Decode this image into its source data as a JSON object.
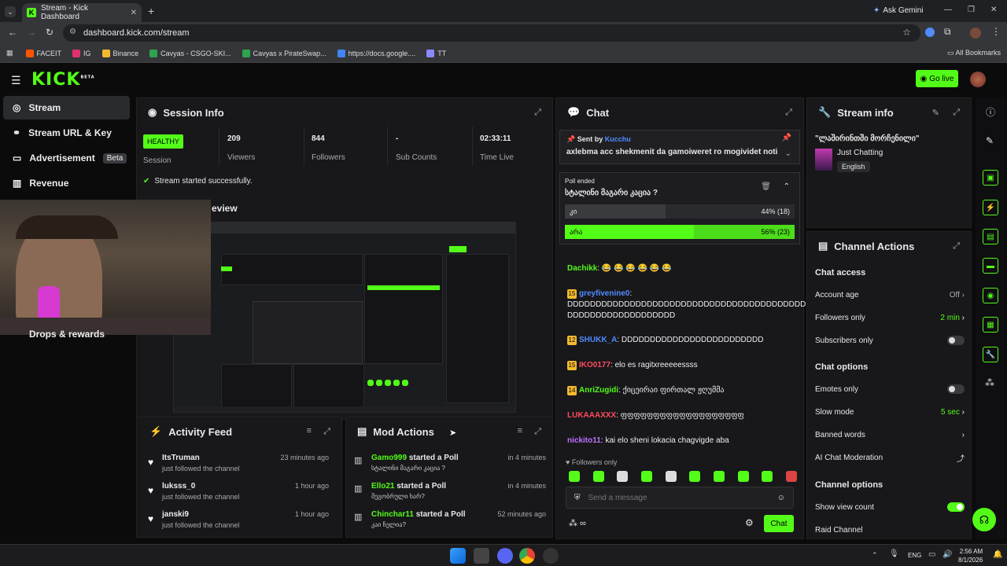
{
  "browser": {
    "tab_title": "Stream - Kick Dashboard",
    "url": "dashboard.kick.com/stream",
    "ask_gemini": "Ask Gemini",
    "bookmarks": [
      "FACEIT",
      "IG",
      "Binance",
      "Cavyas - CSGO-SKI...",
      "Cavyas x PirateSwap...",
      "https://docs.google....",
      "TT"
    ],
    "all_bookmarks": "All Bookmarks"
  },
  "app": {
    "logo": "KICK",
    "beta": "BETA",
    "go_live": "Go live"
  },
  "sidebar": {
    "items": [
      {
        "label": "Stream"
      },
      {
        "label": "Stream URL & Key"
      },
      {
        "label": "Advertisement",
        "badge": "Beta"
      },
      {
        "label": "Revenue"
      },
      {
        "label": "Drops & rewards"
      }
    ]
  },
  "session": {
    "title": "Session Info",
    "health": "HEALTHY",
    "health_label": "Session",
    "viewers": "209",
    "viewers_label": "Viewers",
    "followers": "844",
    "followers_label": "Followers",
    "subs": "-",
    "subs_label": "Sub Counts",
    "time": "02:33:11",
    "time_label": "Time Live",
    "message": "Stream started successfully.",
    "preview_label": "eview"
  },
  "activity": {
    "title": "Activity Feed",
    "items": [
      {
        "name": "ItsTruman",
        "sub": "just followed the channel",
        "time": "23 minutes ago"
      },
      {
        "name": "luksss_0",
        "sub": "just followed the channel",
        "time": "1 hour ago"
      },
      {
        "name": "janski9",
        "sub": "just followed the channel",
        "time": "1 hour ago"
      }
    ]
  },
  "mod": {
    "title": "Mod Actions",
    "items": [
      {
        "name": "Gamo999",
        "action": "started a Poll",
        "sub": "სტალინი მაგარი კაცია ?",
        "time": "in 4 minutes"
      },
      {
        "name": "Ello21",
        "action": "started a Poll",
        "sub": "მეგობრული ხარ?",
        "time": "in 4 minutes"
      },
      {
        "name": "Chinchar11",
        "action": "started a Poll",
        "sub": "კაი ჩელია?",
        "time": "52 minutes ago"
      }
    ]
  },
  "chat": {
    "title": "Chat",
    "pinned_by": "Sent by",
    "pinned_user": "Kucchu",
    "pinned_text": "axlebma acc shekmenit da gamoiweret ro mogividet notifi",
    "poll_status": "Poll ended",
    "poll_question": "სტალინი მაგარი კაცია ?",
    "poll_opts": [
      {
        "label": "კი",
        "result": "44% (18)",
        "fraction": 0.44
      },
      {
        "label": "არა",
        "result": "56% (23)",
        "fraction": 0.56
      }
    ],
    "messages": [
      {
        "user": "Dachikk",
        "color": "#53fc18",
        "text": "😂 😂 😂 😂 😂 😂",
        "lvl": ""
      },
      {
        "user": "greyfivenine0",
        "color": "#4f8cff",
        "text": "DDDDDDDDDDDDDDDDDDDDDDDDDDDDDDDDDDDDDDDDDD DDDDDDDDDDDDDDDDDDD",
        "lvl": "15"
      },
      {
        "user": "SHUKK_A",
        "color": "#4f8cff",
        "text": "DDDDDDDDDDDDDDDDDDDDDDDDD",
        "lvl": "12"
      },
      {
        "user": "IKO0177",
        "color": "#ff4b5c",
        "text": "elo es ragitxreeeeessss",
        "lvl": "15"
      },
      {
        "user": "AnriZugidi",
        "color": "#53fc18",
        "text": "ქიცეირაი ფირთალ ჟღუმმა",
        "lvl": "14"
      },
      {
        "user": "LUKAAAXXX",
        "color": "#ff4b5c",
        "text": "ფფფფფფფფფფფფფფფფფფფ",
        "lvl": ""
      },
      {
        "user": "nickito11",
        "color": "#c071ff",
        "text": "kai elo sheni lokacia chagvigde aba",
        "lvl": ""
      }
    ],
    "followers_only": "Followers only",
    "placeholder": "Send a message",
    "send": "Chat"
  },
  "streaminfo": {
    "title": "Stream info",
    "stream_title": "\"ლაშირინთში მორჩენილი\"",
    "category": "Just Chatting",
    "language": "English"
  },
  "channel": {
    "title": "Channel Actions",
    "chat_access": "Chat access",
    "account_age": "Account age",
    "account_age_val": "Off",
    "followers_only": "Followers only",
    "followers_only_val": "2 min",
    "subscribers_only": "Subscribers only",
    "chat_options": "Chat options",
    "emotes_only": "Emotes only",
    "slow_mode": "Slow mode",
    "slow_mode_val": "5 sec",
    "banned_words": "Banned words",
    "ai_mod": "AI Chat Moderation",
    "channel_options": "Channel options",
    "show_view_count": "Show view count",
    "raid_channel": "Raid Channel"
  },
  "taskbar": {
    "lang": "ENG",
    "time": "2:56 AM",
    "date": "8/1/2026"
  },
  "colors": {
    "accent": "#53fc18",
    "panel": "#18181b",
    "bg": "#0b0b0c"
  }
}
